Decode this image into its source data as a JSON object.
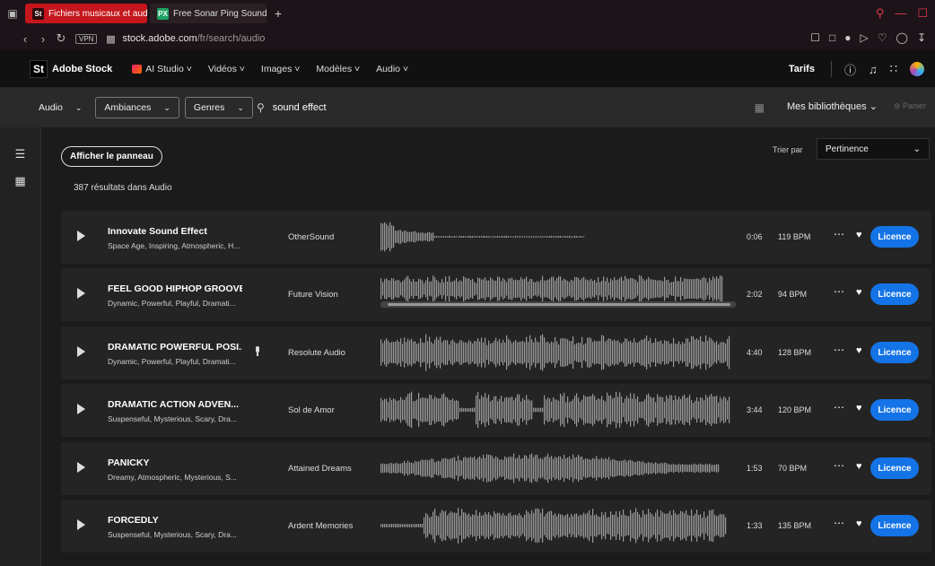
{
  "browser": {
    "tabs": [
      {
        "label": "Fichiers musicaux et audio",
        "favicon": "St",
        "active": true
      },
      {
        "label": "Free Sonar Ping Sound Effects",
        "favicon": "PX",
        "active": false
      }
    ],
    "vpn_label": "VPN",
    "url_host": "stock.adobe.com",
    "url_path": "/fr/search/audio"
  },
  "header": {
    "logo_badge": "St",
    "brand": "Adobe Stock",
    "nav": [
      "AI Studio",
      "Vidéos",
      "Images",
      "Modèles",
      "Audio"
    ],
    "pricing": "Tarifs"
  },
  "search": {
    "scope": "Audio",
    "filter1": "Ambiances",
    "filter2": "Genres",
    "query": "sound effect",
    "libraries": "Mes bibliothèques",
    "cart": "Panier"
  },
  "results": {
    "show_panel": "Afficher le panneau",
    "count_text": "387 résultats dans Audio",
    "sort_label": "Trier par",
    "sort_value": "Pertinence",
    "license_label": "Licence",
    "tracks": [
      {
        "title": "Innovate Sound Effect",
        "tags": "Space Age, Inspiring, Atmospheric, H...",
        "artist": "OtherSound",
        "duration": "0:06",
        "bpm": "119 BPM",
        "vocal": false
      },
      {
        "title": "FEEL GOOD HIPHOP GROOVE",
        "tags": "Dynamic, Powerful, Playful, Dramati...",
        "artist": "Future Vision",
        "duration": "2:02",
        "bpm": "94 BPM",
        "vocal": false
      },
      {
        "title": "DRAMATIC POWERFUL POSI...",
        "tags": "Dynamic, Powerful, Playful, Dramati...",
        "artist": "Resolute Audio",
        "duration": "4:40",
        "bpm": "128 BPM",
        "vocal": true
      },
      {
        "title": "DRAMATIC ACTION ADVEN...",
        "tags": "Suspenseful, Mysterious, Scary, Dra...",
        "artist": "Sol de Amor",
        "duration": "3:44",
        "bpm": "120 BPM",
        "vocal": false
      },
      {
        "title": "PANICKY",
        "tags": "Dreamy, Atmospheric, Mysterious, S...",
        "artist": "Attained Dreams",
        "duration": "1:53",
        "bpm": "70 BPM",
        "vocal": false
      },
      {
        "title": "FORCEDLY",
        "tags": "Suspenseful, Mysterious, Scary, Dra...",
        "artist": "Ardent Memories",
        "duration": "1:33",
        "bpm": "135 BPM",
        "vocal": false
      }
    ]
  },
  "colors": {
    "accent": "#1473e6",
    "browser_accent": "#c4161c",
    "background": "#1b1b1b"
  }
}
